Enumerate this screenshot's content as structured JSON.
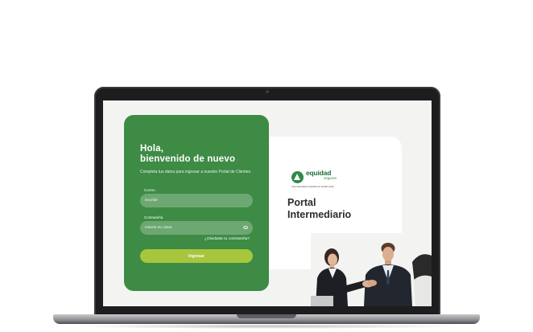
{
  "login": {
    "greeting": "Hola,\nbienvenido de nuevo",
    "subtitle": "Completa tus datos para ingresar a nuestro Portal de Clientes.",
    "email_label": "Correo",
    "email_placeholder": "Escribir",
    "password_label": "Contraseña",
    "password_placeholder": "Inserte su clave",
    "forgot_link": "¿Olvidaste tu contraseña?",
    "submit_label": "Ingresar"
  },
  "brand": {
    "logo_word": "equidad",
    "logo_sub": "seguros",
    "logo_tagline": "Una cooperativa compañía con sentido social",
    "portal_title": "Portal\nIntermediario"
  },
  "colors": {
    "card_green": "#3d8b45",
    "field_green": "#6da872",
    "button_lime": "#a7c63d",
    "brand_green": "#2e8a45"
  }
}
